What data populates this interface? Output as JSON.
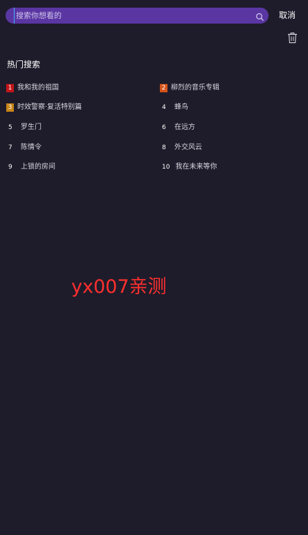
{
  "search": {
    "placeholder": "搜索你想看的",
    "value": ""
  },
  "header": {
    "cancel_label": "取消"
  },
  "hot_search": {
    "title": "热门搜索",
    "items": [
      {
        "rank": "1",
        "text": "我和我的祖国",
        "badge_color": "#c41518"
      },
      {
        "rank": "2",
        "text": "柳烈的音乐专辑",
        "badge_color": "#d4531a"
      },
      {
        "rank": "3",
        "text": "时效警察·复活特别篇",
        "badge_color": "#c98518"
      },
      {
        "rank": "4",
        "text": "蜂鸟"
      },
      {
        "rank": "5",
        "text": "罗生门"
      },
      {
        "rank": "6",
        "text": "在远方"
      },
      {
        "rank": "7",
        "text": "陈情令"
      },
      {
        "rank": "8",
        "text": "外交风云"
      },
      {
        "rank": "9",
        "text": "上锁的房间"
      },
      {
        "rank": "10",
        "text": "我在未来等你"
      }
    ]
  },
  "watermark": {
    "text": "yx007亲测"
  },
  "colors": {
    "background": "#1e1c2a",
    "search_bar": "#5a36a3",
    "watermark": "#ff2f2f"
  },
  "icons": [
    "search-icon",
    "trash-icon"
  ]
}
